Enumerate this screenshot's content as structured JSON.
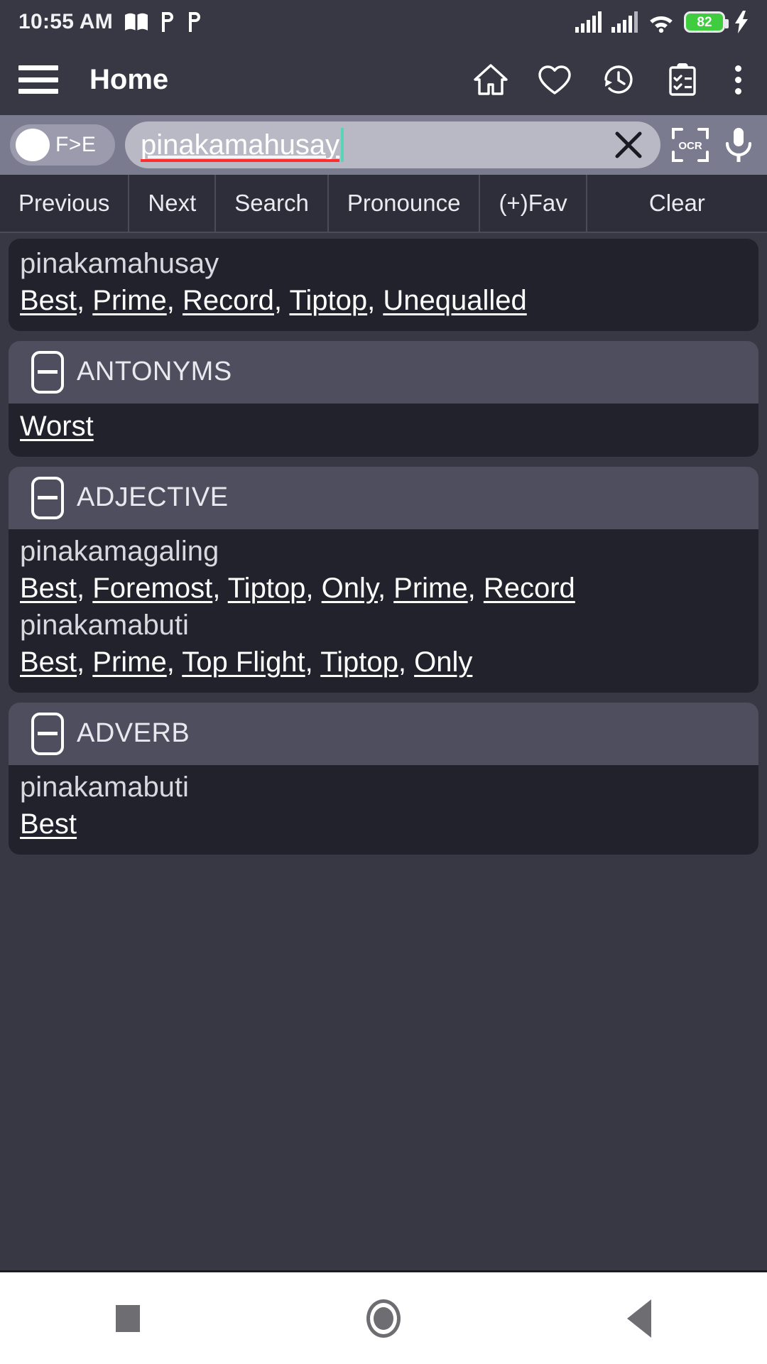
{
  "statusbar": {
    "time": "10:55 AM",
    "left_icons": [
      "book-icon",
      "p-badge-icon",
      "p-badge-icon"
    ],
    "right_icons": [
      "signal-bars-icon",
      "signal-bars-icon",
      "wifi-icon"
    ],
    "battery_percent": "82",
    "battery_color": "#3fcc3f",
    "charging": true
  },
  "appbar": {
    "menu_icon": "hamburger-icon",
    "title": "Home",
    "actions": [
      "home-icon",
      "heart-icon",
      "history-icon",
      "clipboard-checklist-icon",
      "overflow-menu-icon"
    ]
  },
  "search": {
    "lang_toggle_label": "F>E",
    "lang_toggle_on": false,
    "value": "pinakamahusay",
    "placeholder": "",
    "spellcheck_underline": true,
    "caret_color": "#57d6b6",
    "clear_icon": "close-icon",
    "ocr_label": "OCR",
    "ocr_icon": "ocr-scan-icon",
    "mic_icon": "microphone-icon"
  },
  "buttonbar": {
    "buttons": [
      {
        "label": "Previous"
      },
      {
        "label": "Next"
      },
      {
        "label": "Search"
      },
      {
        "label": "Pronounce"
      },
      {
        "label": "(+)Fav"
      },
      {
        "label": "Clear"
      }
    ]
  },
  "results": {
    "main_entry": {
      "headword": "pinakamahusay",
      "synonyms": [
        "Best",
        "Prime",
        "Record",
        "Tiptop",
        "Unequalled"
      ]
    },
    "sections": [
      {
        "title": "ANTONYMS",
        "collapse_icon": "minus-box-icon",
        "entries": [
          {
            "headword": "",
            "synonyms": [
              "Worst"
            ]
          }
        ]
      },
      {
        "title": "ADJECTIVE",
        "collapse_icon": "minus-box-icon",
        "entries": [
          {
            "headword": "pinakamagaling",
            "synonyms": [
              "Best",
              "Foremost",
              "Tiptop",
              "Only",
              "Prime",
              "Record"
            ]
          },
          {
            "headword": "pinakamabuti",
            "synonyms": [
              "Best",
              "Prime",
              "Top Flight",
              "Tiptop",
              "Only"
            ]
          }
        ]
      },
      {
        "title": "ADVERB",
        "collapse_icon": "minus-box-icon",
        "entries": [
          {
            "headword": "pinakamabuti",
            "synonyms": [
              "Best"
            ]
          }
        ]
      }
    ]
  },
  "navbar": {
    "recents_icon": "square-icon",
    "home_icon": "circle-icon",
    "back_icon": "triangle-back-icon"
  },
  "colors": {
    "page_background": "#383845",
    "card_background": "#22222c",
    "section_header": "#4e4e5e",
    "search_row": "#7b7b8f",
    "search_field": "#b9b9c6",
    "button_bar": "#2e2e3a",
    "accent_caret": "#57d6b6",
    "spell_error": "#ff2d2d",
    "navbar_background": "#ffffff"
  }
}
